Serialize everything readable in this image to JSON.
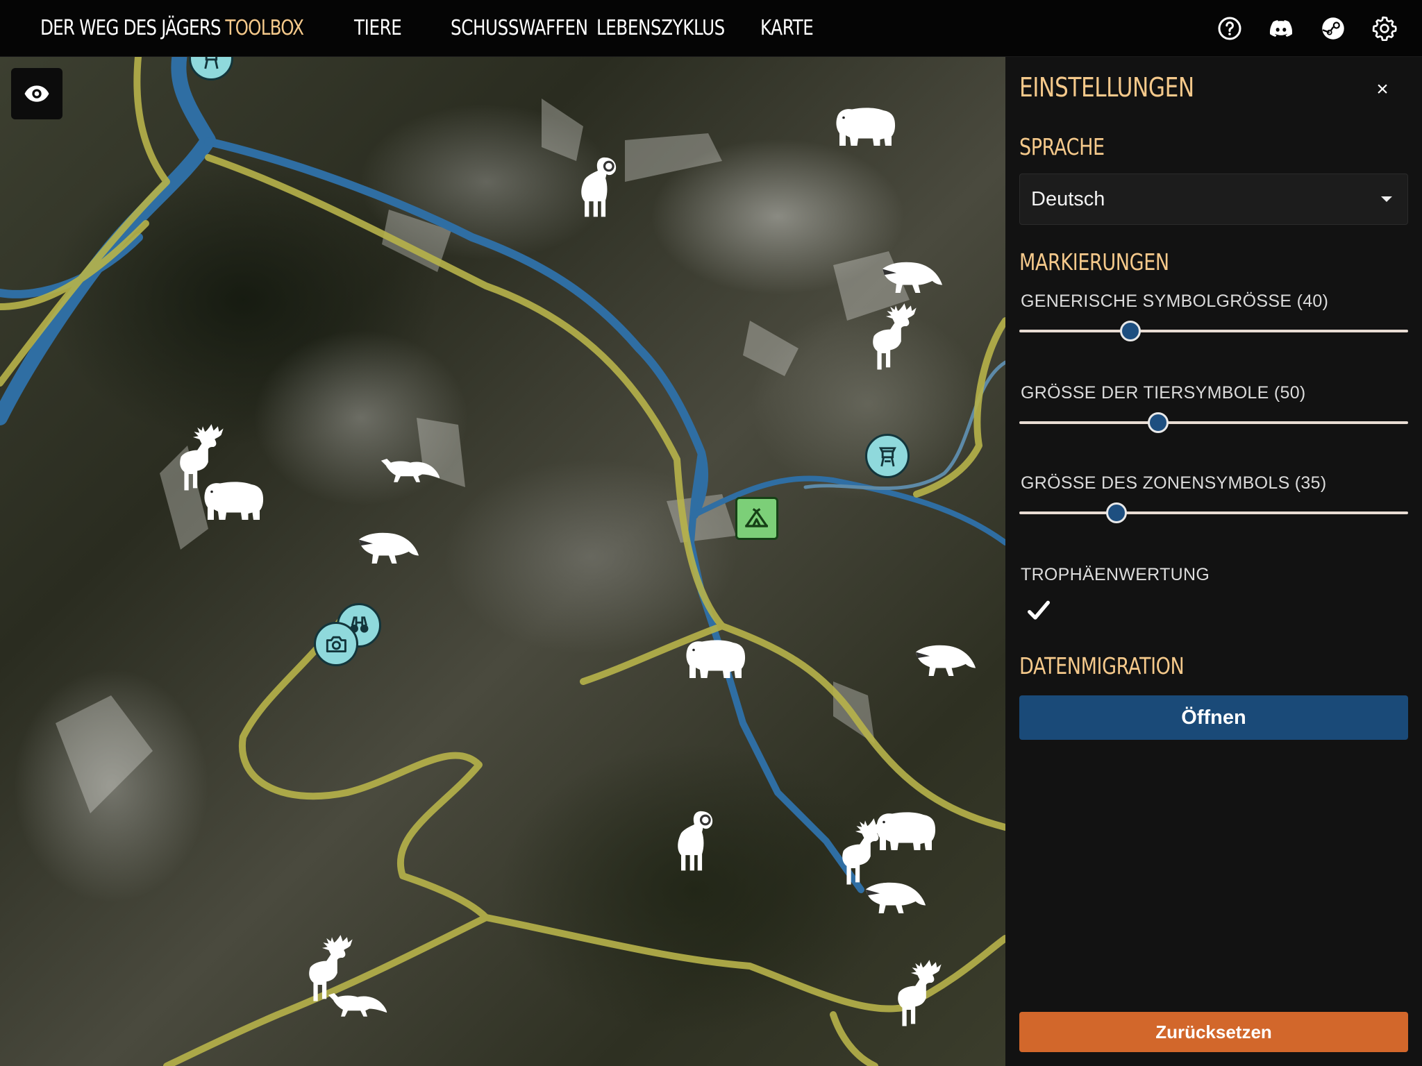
{
  "app": {
    "title_main": "DER WEG DES JÄGERS",
    "title_accent": "TOOLBOX"
  },
  "nav": {
    "items": [
      {
        "label": "TIERE"
      },
      {
        "label": "SCHUSSWAFFEN"
      },
      {
        "label": "LEBENSZYKLUS"
      },
      {
        "label": "KARTE"
      }
    ]
  },
  "header_icons": [
    "help-icon",
    "discord-icon",
    "steam-icon",
    "settings-gear-icon"
  ],
  "settings": {
    "title": "EINSTELLUNGEN",
    "close_symbol": "×",
    "language_section": "SPRACHE",
    "language_value": "Deutsch",
    "markers_section": "MARKIERUNGEN",
    "sliders": [
      {
        "label": "GENERISCHE SYMBOLGRÖSSE (40)",
        "value": 40,
        "min": 0,
        "max": 140
      },
      {
        "label": "GRÖSSE DER TIERSYMBOLE (50)",
        "value": 50,
        "min": 0,
        "max": 140
      },
      {
        "label": "GRÖSSE DES ZONENSYMBOLS (35)",
        "value": 35,
        "min": 0,
        "max": 140
      }
    ],
    "trophy_label": "TROPHÄENWERTUNG",
    "trophy_checked": true,
    "migration_section": "DATENMIGRATION",
    "open_button": "Öffnen",
    "reset_button": "Zurücksetzen"
  },
  "colors": {
    "accent": "#f5c98b",
    "primary_button": "#1a4a78",
    "reset_button": "#d2672b",
    "poi": "#8fd9dc",
    "zone": "#7ccf78",
    "river": "#2f6ea3",
    "road": "#b7b34a"
  },
  "map_markers": [
    {
      "type": "animal",
      "icon": "bear-icon"
    },
    {
      "type": "animal",
      "icon": "ram-icon"
    },
    {
      "type": "animal",
      "icon": "badger-icon"
    },
    {
      "type": "animal",
      "icon": "deer-icon"
    },
    {
      "type": "poi",
      "icon": "hunting-stand-icon"
    },
    {
      "type": "zone",
      "icon": "tent-icon"
    },
    {
      "type": "animal",
      "icon": "deer-icon"
    },
    {
      "type": "animal",
      "icon": "bear-icon"
    },
    {
      "type": "animal",
      "icon": "fox-icon"
    },
    {
      "type": "animal",
      "icon": "badger-icon"
    },
    {
      "type": "poi",
      "icon": "binoculars-icon"
    },
    {
      "type": "poi",
      "icon": "camera-icon"
    },
    {
      "type": "animal",
      "icon": "badger-icon"
    },
    {
      "type": "animal",
      "icon": "bear-icon"
    },
    {
      "type": "animal",
      "icon": "ram-icon"
    },
    {
      "type": "animal",
      "icon": "bear-icon"
    },
    {
      "type": "animal",
      "icon": "deer-icon"
    },
    {
      "type": "animal",
      "icon": "badger-icon"
    },
    {
      "type": "animal",
      "icon": "deer-icon"
    },
    {
      "type": "animal",
      "icon": "fox-icon"
    },
    {
      "type": "animal",
      "icon": "deer-icon"
    }
  ]
}
